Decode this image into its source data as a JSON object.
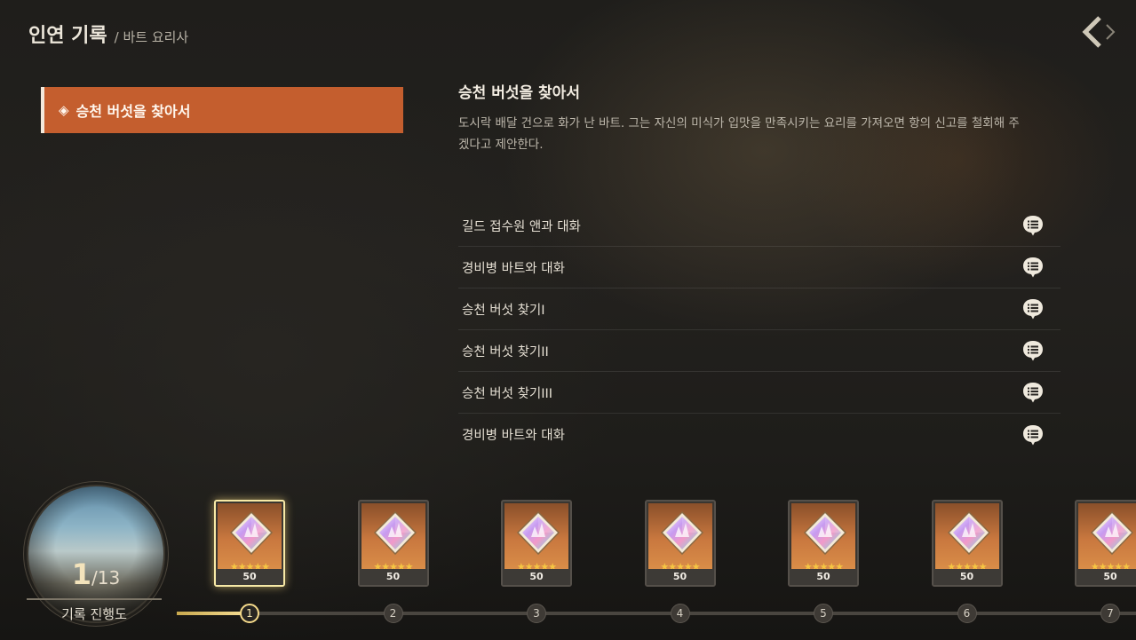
{
  "header": {
    "title": "인연 기록",
    "subtitle": "/ 바트 요리사",
    "back_icon": "back-arrow-icon"
  },
  "quest_list": {
    "items": [
      {
        "label": "승천 버섯을 찾아서",
        "icon": "diamond-icon"
      }
    ]
  },
  "detail": {
    "title": "승천 버섯을 찾아서",
    "description": "도시락 배달 건으로 화가 난 바트. 그는 자신의 미식가 입맛을 만족시키는 요리를 가져오면 항의 신고를 철회해 주겠다고 제안한다."
  },
  "steps": [
    {
      "label": "길드 접수원 앤과 대화",
      "icon": "chat-bubble-icon"
    },
    {
      "label": "경비병 바트와 대화",
      "icon": "chat-bubble-icon"
    },
    {
      "label": "승천 버섯 찾기I",
      "icon": "chat-bubble-icon"
    },
    {
      "label": "승천 버섯 찾기II",
      "icon": "chat-bubble-icon"
    },
    {
      "label": "승천 버섯 찾기III",
      "icon": "chat-bubble-icon"
    },
    {
      "label": "경비병 바트와 대화",
      "icon": "chat-bubble-icon"
    }
  ],
  "progress": {
    "current": "1",
    "total": "/13",
    "label": "기록 진행도"
  },
  "rewards": [
    {
      "stars": "★★★★★",
      "quantity": "50",
      "icon": "crystal-gem-icon",
      "active": true
    },
    {
      "stars": "★★★★★",
      "quantity": "50",
      "icon": "crystal-gem-icon",
      "active": false
    },
    {
      "stars": "★★★★★",
      "quantity": "50",
      "icon": "crystal-gem-icon",
      "active": false
    },
    {
      "stars": "★★★★★",
      "quantity": "50",
      "icon": "crystal-gem-icon",
      "active": false
    },
    {
      "stars": "★★★★★",
      "quantity": "50",
      "icon": "crystal-gem-icon",
      "active": false
    },
    {
      "stars": "★★★★★",
      "quantity": "50",
      "icon": "crystal-gem-icon",
      "active": false
    },
    {
      "stars": "★★★★★",
      "quantity": "50",
      "icon": "crystal-gem-icon",
      "active": false
    }
  ],
  "timeline": {
    "nodes": [
      "1",
      "2",
      "3",
      "4",
      "5",
      "6",
      "7"
    ],
    "active_index": 0
  },
  "colors": {
    "accent": "#c45e2e",
    "gold": "#f4d98a",
    "background": "#1b1a18"
  }
}
